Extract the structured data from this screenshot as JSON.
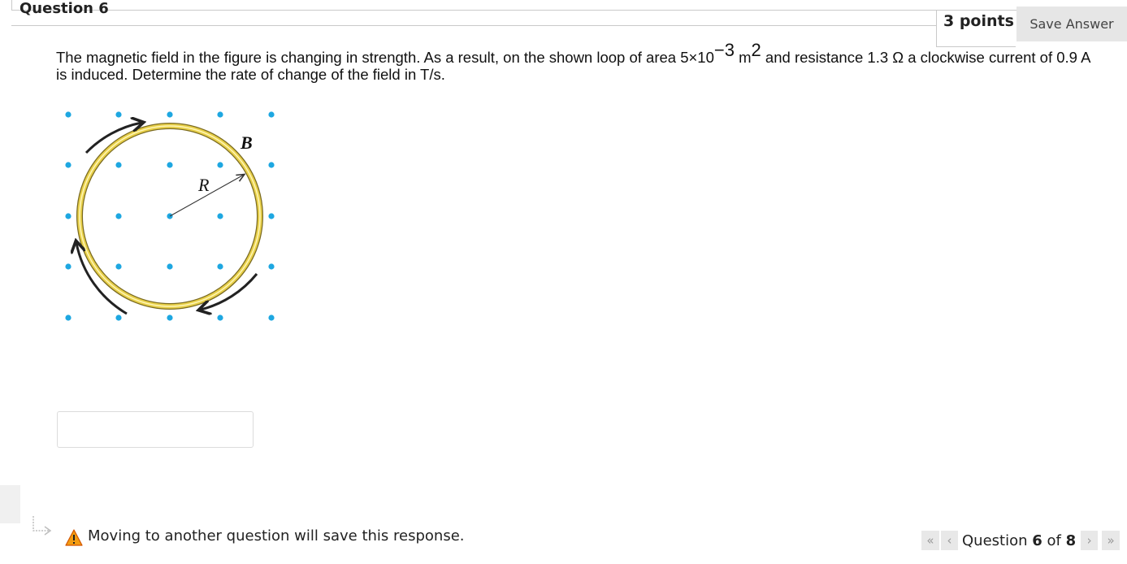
{
  "header": {
    "question_title": "Question 6",
    "points": "3 points",
    "save_label": "Save Answer"
  },
  "question": {
    "text_before_exp": "The magnetic field in the figure is changing in strength. As a result, on the shown loop of area 5×10",
    "exp1": "−3",
    "unit": " m",
    "exp2": "2",
    "text_after_exp": " and resistance 1.3 Ω a clockwise current of 0.9 A is induced. Determine the rate of change of the field in T/s."
  },
  "figure": {
    "field_label": "B",
    "radius_label": "R",
    "dot_color": "#1ea7e1",
    "loop_color": "#e8d04a"
  },
  "answer": {
    "value": "",
    "placeholder": ""
  },
  "footer": {
    "message": "Moving to another question will save this response.",
    "question_word": "Question",
    "current": "6",
    "of_word": "of",
    "total": "8",
    "first_icon": "«",
    "prev_icon": "‹",
    "next_icon": "›",
    "last_icon": "»"
  }
}
